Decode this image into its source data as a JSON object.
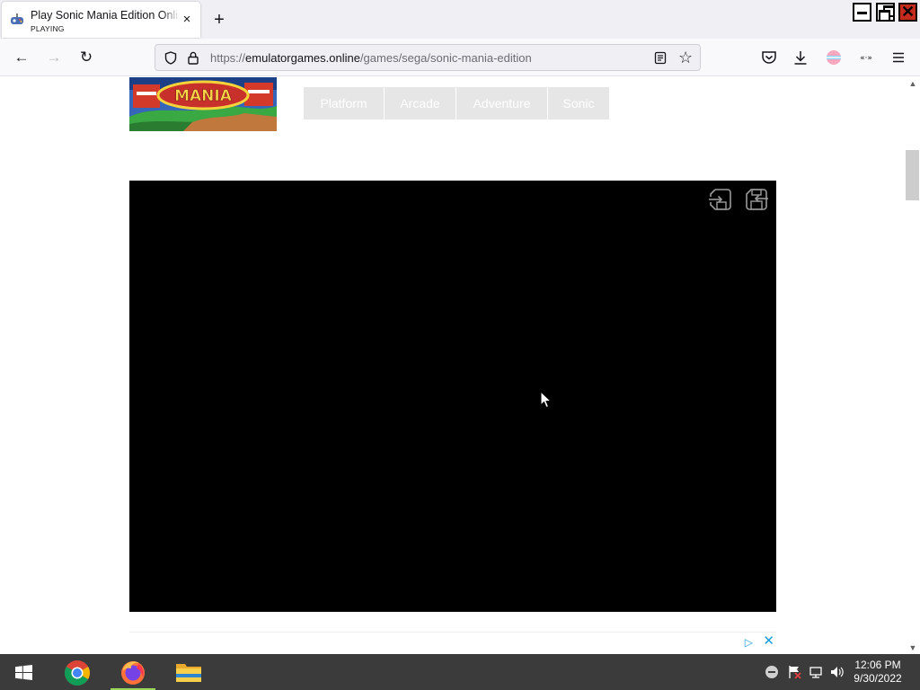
{
  "browser": {
    "tab": {
      "title": "Play Sonic Mania Edition Online",
      "status": "PLAYING",
      "close_glyph": "×"
    },
    "new_tab_glyph": "+",
    "nav": {
      "back_glyph": "←",
      "forward_glyph": "→",
      "reload_glyph": "↻"
    },
    "url": {
      "scheme": "https://",
      "host": "emulatorgames.online",
      "path": "/games/sega/sonic-mania-edition"
    },
    "bookmark_glyph": "☆",
    "toolbar_icons": [
      "pocket-icon",
      "downloads-icon",
      "account-icon",
      "extensions-icon",
      "menu-icon"
    ],
    "window_close_glyph": "✕"
  },
  "page": {
    "tags": [
      "Platform",
      "Arcade",
      "Adventure",
      "Sonic"
    ],
    "game_logo_text": "MANIA",
    "game_frame": {
      "icons": [
        "load-state-icon",
        "save-state-icon"
      ]
    },
    "ad": {
      "choices_glyph": "▷",
      "close_glyph": "✕"
    },
    "scrollbar": {
      "up_glyph": "▲",
      "down_glyph": "▼",
      "position": 0.12
    }
  },
  "taskbar": {
    "apps": [
      "Google Chrome",
      "Firefox",
      "File Explorer"
    ],
    "active_app": "Firefox",
    "clock": {
      "time": "12:06 PM",
      "date": "9/30/2022"
    }
  },
  "colors": {
    "tab_strip": "#f0f0f4",
    "toolbar": "#f9f9fb",
    "tag_bg": "#e6e6e6",
    "game_bg": "#000000",
    "taskbar": "#3b3b3b",
    "window_close": "#c42b1c",
    "ad_blue": "#1a9bd7"
  }
}
